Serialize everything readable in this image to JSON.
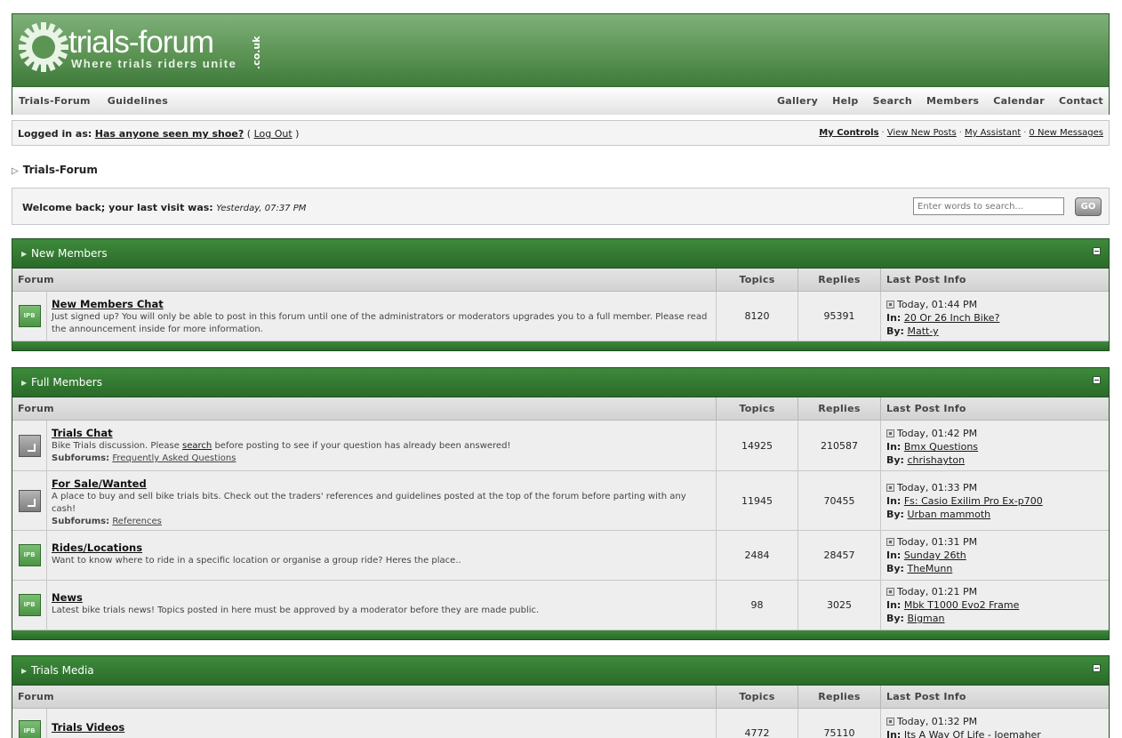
{
  "logo": {
    "title": "trials-forum",
    "tagline": "Where trials riders unite",
    "domain_suffix": ".co.uk"
  },
  "nav": {
    "left": [
      "Trials-Forum",
      "Guidelines"
    ],
    "right": [
      "Gallery",
      "Help",
      "Search",
      "Members",
      "Calendar",
      "Contact"
    ]
  },
  "userbar": {
    "logged_in_label": "Logged in as:",
    "username": "Has anyone seen my shoe?",
    "logout": "Log Out",
    "links": [
      "My Controls",
      "View New Posts",
      "My Assistant",
      "0 New Messages"
    ]
  },
  "breadcrumb": "Trials-Forum",
  "welcome": {
    "text": "Welcome back; your last visit was:",
    "last_visit": "Yesterday, 07:37 PM",
    "search_placeholder": "Enter words to search...",
    "go_label": "GO"
  },
  "columns": {
    "forum": "Forum",
    "topics": "Topics",
    "replies": "Replies",
    "last": "Last Post Info"
  },
  "labels": {
    "in": "In:",
    "by": "By:",
    "subforums": "Subforums:"
  },
  "categories": [
    {
      "title": "New Members",
      "forums": [
        {
          "icon": "ipb-icon",
          "name": "New Members Chat",
          "desc": "Just signed up? You will only be able to post in this forum until one of the administrators or moderators upgrades you to a full member. Please read the announcement inside for more information.",
          "topics": "8120",
          "replies": "95391",
          "last_time": "Today, 01:44 PM",
          "last_in": "20 Or 26 Inch Bike?",
          "last_by": "Matt-y"
        }
      ]
    },
    {
      "title": "Full Members",
      "forums": [
        {
          "icon": "redirect-icon",
          "name": "Trials Chat",
          "desc_pre": "Bike Trials discussion. Please ",
          "desc_link": "search",
          "desc_post": " before posting to see if your question has already been answered!",
          "subforums": "Frequently Asked Questions",
          "topics": "14925",
          "replies": "210587",
          "last_time": "Today, 01:42 PM",
          "last_in": "Bmx Questions",
          "last_by": "chrishayton"
        },
        {
          "icon": "redirect-icon",
          "name": "For Sale/Wanted",
          "desc": "A place to buy and sell bike trials bits. Check out the traders' references and guidelines posted at the top of the forum before parting with any cash!",
          "subforums": "References",
          "topics": "11945",
          "replies": "70455",
          "last_time": "Today, 01:33 PM",
          "last_in": "Fs: Casio Exilim Pro Ex-p700",
          "last_by": "Urban mammoth"
        },
        {
          "icon": "ipb-icon",
          "name": "Rides/Locations",
          "desc": "Want to know where to ride in a specific location or organise a group ride? Heres the place..",
          "topics": "2484",
          "replies": "28457",
          "last_time": "Today, 01:31 PM",
          "last_in": "Sunday 26th",
          "last_by": "TheMunn"
        },
        {
          "icon": "ipb-icon",
          "name": "News",
          "desc": "Latest bike trials news! Topics posted in here must be approved by a moderator before they are made public.",
          "topics": "98",
          "replies": "3025",
          "last_time": "Today, 01:21 PM",
          "last_in": "Mbk T1000 Evo2 Frame",
          "last_by": "Bigman"
        }
      ]
    },
    {
      "title": "Trials Media",
      "forums": [
        {
          "icon": "ipb-icon",
          "name": "Trials Videos",
          "topics": "4772",
          "replies": "75110",
          "last_time": "Today, 01:32 PM",
          "last_in": "Its A Way Of Life - Joemaher"
        }
      ]
    }
  ],
  "icon_text": "IPB",
  "colors": {
    "brand_green": "#2a6b29",
    "banner_green": "#5c9454",
    "row_bg": "#eeeeee"
  }
}
